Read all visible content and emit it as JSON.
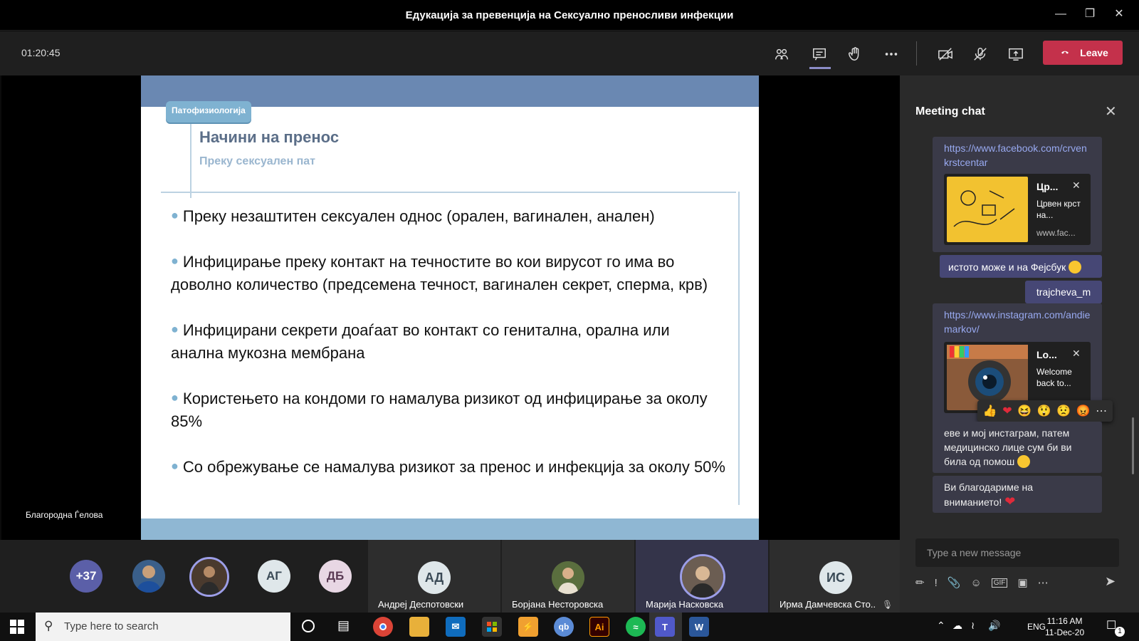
{
  "window": {
    "title": "Едукација за превенција на Сексуално преносливи инфекции"
  },
  "toolbar": {
    "timer": "01:20:45",
    "leave_label": "Leave"
  },
  "slide": {
    "tag": "Патофизиологија",
    "heading": "Начини на пренос",
    "subheading": "Преку сексуален пат",
    "bullets": [
      "Преку незаштитен сексуален однос (орален, вагинален, анален)",
      "Инфицирање преку контакт на течностите во кои вирусот го има во доволно количество (предсемена течност, вагинален секрет, сперма, крв)",
      "Инфицирани секрети доаѓаат во контакт со генитална, орална или анална мукозна мембрана",
      "Користењето на кондоми го намалува ризикот од инфицирање за околу 85%",
      "Со обрежување се намалува ризикот за пренос и инфекција за околу 50%"
    ]
  },
  "presenter": {
    "name": "Благородна Ѓелова"
  },
  "chat": {
    "title": "Meeting chat",
    "msg1_link": "https://www.facebook.com/crvenkrstcentar",
    "card1": {
      "title": "Цр...",
      "desc": "Црвен крст на...",
      "url": "www.fac..."
    },
    "mine1": "истото може и на Фејсбук",
    "mine2": "trajcheva_m",
    "msg2_link": "https://www.instagram.com/andiemarkov/",
    "card2": {
      "title": "Lo...",
      "desc": "Welcome back to..."
    },
    "msg3": "еве и мој инстаграм, патем медицинско лице сум би ви била од помош",
    "msg4": "Ви благодариме на вниманието!",
    "compose_placeholder": "Type a new message",
    "reactions": [
      "like",
      "heart",
      "laugh",
      "surprised",
      "sad",
      "angry",
      "more"
    ]
  },
  "participants": {
    "overflow": "+37",
    "avatars": [
      {
        "initials": "АГ",
        "color": "#dfe7ea"
      },
      {
        "initials": "ДБ",
        "color": "#e8d7e4"
      }
    ],
    "tiles": [
      {
        "initials": "АД",
        "name": "Андреј Деспотовски"
      },
      {
        "name": "Борјана Несторовска"
      },
      {
        "name": "Марија Насковска"
      },
      {
        "initials": "ИС",
        "name": "Ирма Дамчевска Сто..."
      }
    ]
  },
  "taskbar": {
    "search_placeholder": "Type here to search",
    "lang": "ENG",
    "time": "11:16 AM",
    "date": "11-Dec-20",
    "notifications": "1"
  }
}
